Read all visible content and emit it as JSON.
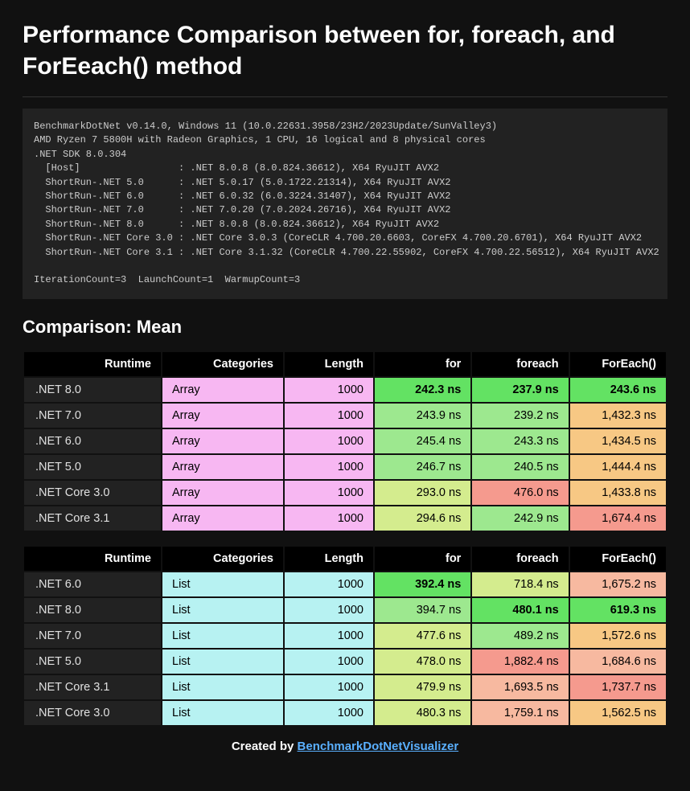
{
  "title": "Performance Comparison between for, foreach, and ForEeach() method",
  "env_text": "BenchmarkDotNet v0.14.0, Windows 11 (10.0.22631.3958/23H2/2023Update/SunValley3)\nAMD Ryzen 7 5800H with Radeon Graphics, 1 CPU, 16 logical and 8 physical cores\n.NET SDK 8.0.304\n  [Host]                 : .NET 8.0.8 (8.0.824.36612), X64 RyuJIT AVX2\n  ShortRun-.NET 5.0      : .NET 5.0.17 (5.0.1722.21314), X64 RyuJIT AVX2\n  ShortRun-.NET 6.0      : .NET 6.0.32 (6.0.3224.31407), X64 RyuJIT AVX2\n  ShortRun-.NET 7.0      : .NET 7.0.20 (7.0.2024.26716), X64 RyuJIT AVX2\n  ShortRun-.NET 8.0      : .NET 8.0.8 (8.0.824.36612), X64 RyuJIT AVX2\n  ShortRun-.NET Core 3.0 : .NET Core 3.0.3 (CoreCLR 4.700.20.6603, CoreFX 4.700.20.6701), X64 RyuJIT AVX2\n  ShortRun-.NET Core 3.1 : .NET Core 3.1.32 (CoreCLR 4.700.22.55902, CoreFX 4.700.22.56512), X64 RyuJIT AVX2\n\nIterationCount=3  LaunchCount=1  WarmupCount=3",
  "section_heading": "Comparison: Mean",
  "headers": {
    "runtime": "Runtime",
    "categories": "Categories",
    "length": "Length",
    "for": "for",
    "foreach": "foreach",
    "foreach_method": "ForEach()"
  },
  "colors": {
    "runtime_bg": "#222",
    "runtime_fg": "#e0e0e0",
    "pink": "#f7b7f2",
    "cyan": "#b7f2f2",
    "green_best": "#63e263",
    "green_good": "#9de88f",
    "yellowgreen": "#d4ec8e",
    "orange": "#f7c884",
    "red": "#f59a8e",
    "salmon": "#f7b9a0"
  },
  "tables": [
    {
      "cat_color_key": "pink",
      "rows": [
        {
          "runtime": ".NET 8.0",
          "cat": "Array",
          "len": "1000",
          "for": {
            "v": "242.3 ns",
            "c": "green_best",
            "b": true
          },
          "foreach": {
            "v": "237.9 ns",
            "c": "green_best",
            "b": true
          },
          "fe": {
            "v": "243.6 ns",
            "c": "green_best",
            "b": true
          }
        },
        {
          "runtime": ".NET 7.0",
          "cat": "Array",
          "len": "1000",
          "for": {
            "v": "243.9 ns",
            "c": "green_good"
          },
          "foreach": {
            "v": "239.2 ns",
            "c": "green_good"
          },
          "fe": {
            "v": "1,432.3 ns",
            "c": "orange"
          }
        },
        {
          "runtime": ".NET 6.0",
          "cat": "Array",
          "len": "1000",
          "for": {
            "v": "245.4 ns",
            "c": "green_good"
          },
          "foreach": {
            "v": "243.3 ns",
            "c": "green_good"
          },
          "fe": {
            "v": "1,434.5 ns",
            "c": "orange"
          }
        },
        {
          "runtime": ".NET 5.0",
          "cat": "Array",
          "len": "1000",
          "for": {
            "v": "246.7 ns",
            "c": "green_good"
          },
          "foreach": {
            "v": "240.5 ns",
            "c": "green_good"
          },
          "fe": {
            "v": "1,444.4 ns",
            "c": "orange"
          }
        },
        {
          "runtime": ".NET Core 3.0",
          "cat": "Array",
          "len": "1000",
          "for": {
            "v": "293.0 ns",
            "c": "yellowgreen"
          },
          "foreach": {
            "v": "476.0 ns",
            "c": "red"
          },
          "fe": {
            "v": "1,433.8 ns",
            "c": "orange"
          }
        },
        {
          "runtime": ".NET Core 3.1",
          "cat": "Array",
          "len": "1000",
          "for": {
            "v": "294.6 ns",
            "c": "yellowgreen"
          },
          "foreach": {
            "v": "242.9 ns",
            "c": "green_good"
          },
          "fe": {
            "v": "1,674.4 ns",
            "c": "red"
          }
        }
      ]
    },
    {
      "cat_color_key": "cyan",
      "rows": [
        {
          "runtime": ".NET 6.0",
          "cat": "List",
          "len": "1000",
          "for": {
            "v": "392.4 ns",
            "c": "green_best",
            "b": true
          },
          "foreach": {
            "v": "718.4 ns",
            "c": "yellowgreen"
          },
          "fe": {
            "v": "1,675.2 ns",
            "c": "salmon"
          }
        },
        {
          "runtime": ".NET 8.0",
          "cat": "List",
          "len": "1000",
          "for": {
            "v": "394.7 ns",
            "c": "green_good"
          },
          "foreach": {
            "v": "480.1 ns",
            "c": "green_best",
            "b": true
          },
          "fe": {
            "v": "619.3 ns",
            "c": "green_best",
            "b": true
          }
        },
        {
          "runtime": ".NET 7.0",
          "cat": "List",
          "len": "1000",
          "for": {
            "v": "477.6 ns",
            "c": "yellowgreen"
          },
          "foreach": {
            "v": "489.2 ns",
            "c": "green_good"
          },
          "fe": {
            "v": "1,572.6 ns",
            "c": "orange"
          }
        },
        {
          "runtime": ".NET 5.0",
          "cat": "List",
          "len": "1000",
          "for": {
            "v": "478.0 ns",
            "c": "yellowgreen"
          },
          "foreach": {
            "v": "1,882.4 ns",
            "c": "red"
          },
          "fe": {
            "v": "1,684.6 ns",
            "c": "salmon"
          }
        },
        {
          "runtime": ".NET Core 3.1",
          "cat": "List",
          "len": "1000",
          "for": {
            "v": "479.9 ns",
            "c": "yellowgreen"
          },
          "foreach": {
            "v": "1,693.5 ns",
            "c": "salmon"
          },
          "fe": {
            "v": "1,737.7 ns",
            "c": "red"
          }
        },
        {
          "runtime": ".NET Core 3.0",
          "cat": "List",
          "len": "1000",
          "for": {
            "v": "480.3 ns",
            "c": "yellowgreen"
          },
          "foreach": {
            "v": "1,759.1 ns",
            "c": "salmon"
          },
          "fe": {
            "v": "1,562.5 ns",
            "c": "orange"
          }
        }
      ]
    }
  ],
  "footer": {
    "prefix": "Created by ",
    "link_text": "BenchmarkDotNetVisualizer"
  }
}
